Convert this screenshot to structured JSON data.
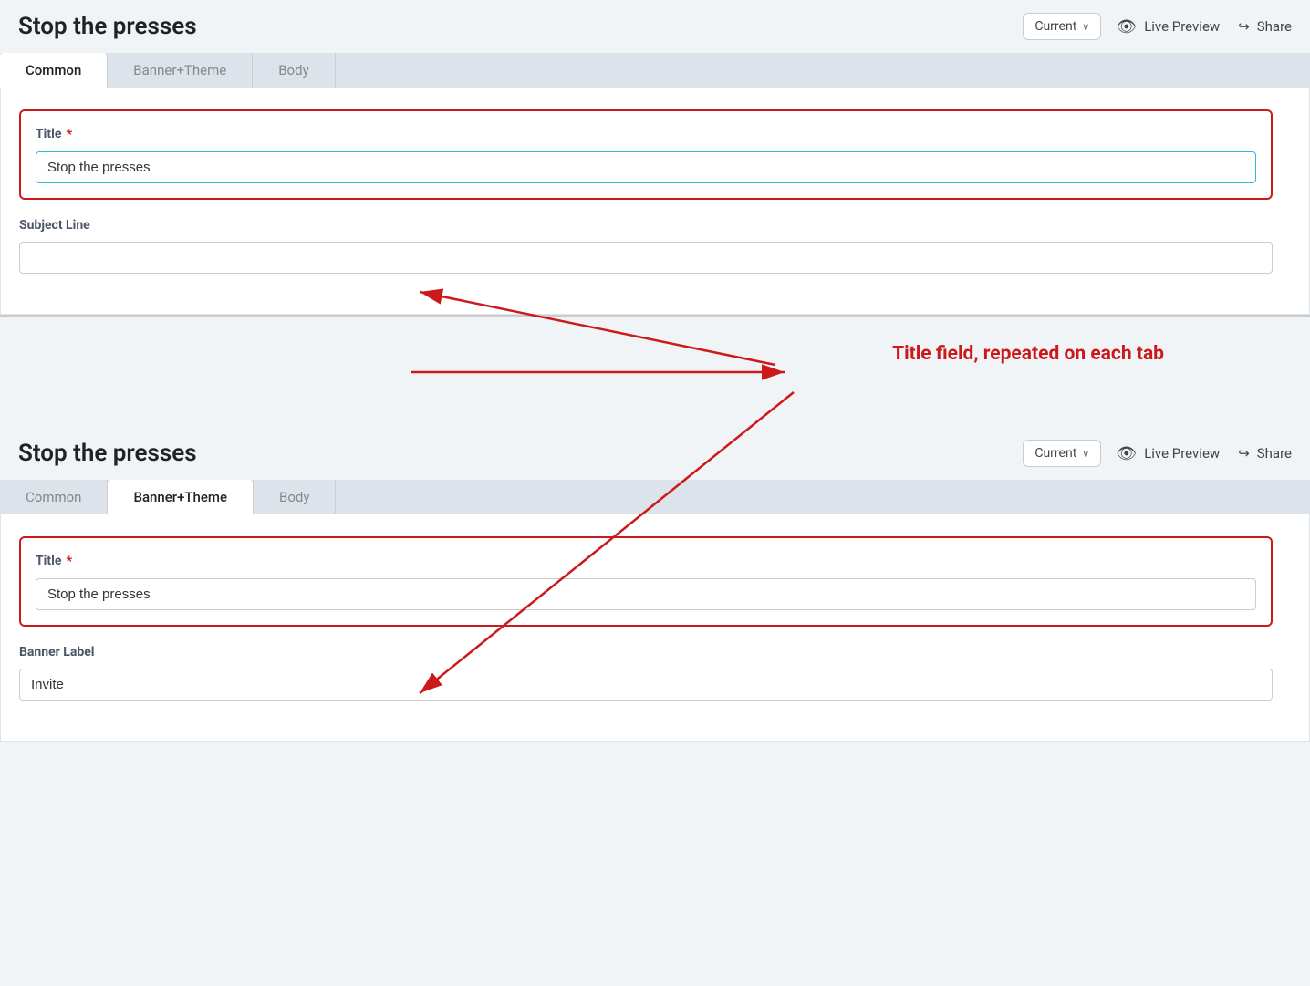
{
  "page": {
    "title": "Stop the presses"
  },
  "header": {
    "title": "Stop the presses",
    "version_label": "Current",
    "version_chevron": "∨",
    "live_preview_label": "Live Preview",
    "share_label": "Share"
  },
  "tabs": {
    "items": [
      {
        "id": "common",
        "label": "Common"
      },
      {
        "id": "banner-theme",
        "label": "Banner+Theme"
      },
      {
        "id": "body",
        "label": "Body"
      }
    ]
  },
  "top_section": {
    "active_tab": "Common",
    "title_field": {
      "label": "Title",
      "required": "*",
      "value": "Stop the presses",
      "placeholder": ""
    },
    "subject_line_field": {
      "label": "Subject Line",
      "value": "",
      "placeholder": ""
    }
  },
  "bottom_section": {
    "active_tab": "Banner+Theme",
    "title_field": {
      "label": "Title",
      "required": "*",
      "value": "Stop the presses",
      "placeholder": ""
    },
    "banner_label_field": {
      "label": "Banner Label",
      "value": "Invite",
      "placeholder": ""
    }
  },
  "annotation": {
    "text": "Title field, repeated on each tab"
  },
  "icons": {
    "eye": "👁",
    "share": "↪",
    "chevron_down": "∨"
  }
}
